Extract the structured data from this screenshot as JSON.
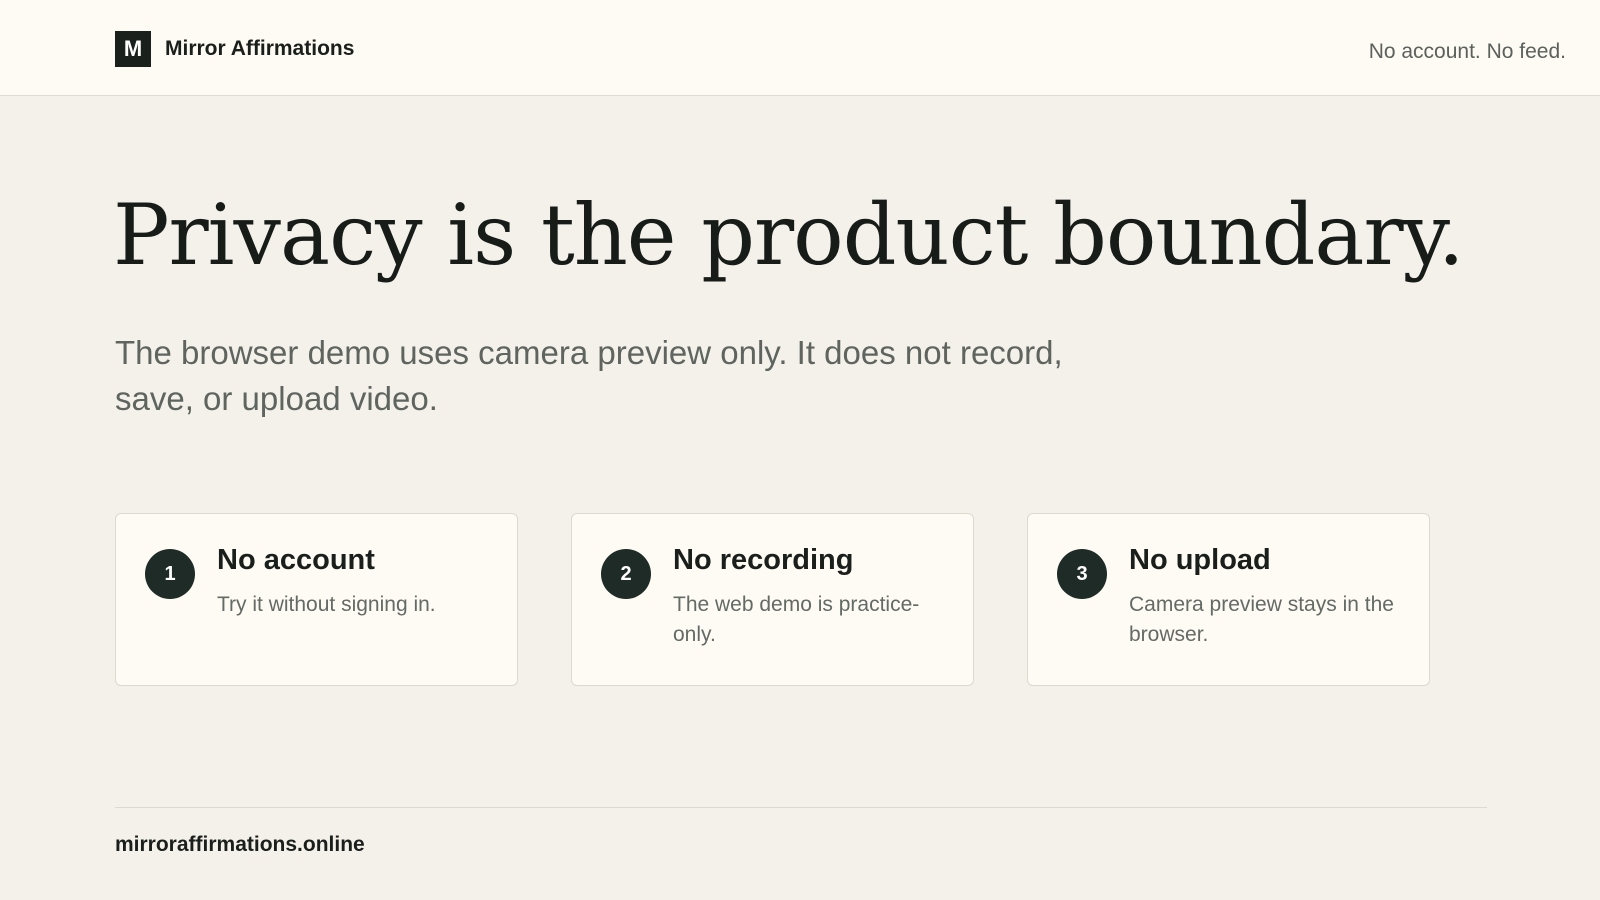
{
  "header": {
    "logo_letter": "M",
    "brand_name": "Mirror Affirmations",
    "tagline": "No account. No feed."
  },
  "hero": {
    "title": "Privacy is the product boundary.",
    "subtitle": "The browser demo uses camera preview only. It does not record, save, or upload video."
  },
  "cards": [
    {
      "number": "1",
      "title": "No account",
      "description": "Try it without signing in."
    },
    {
      "number": "2",
      "title": "No recording",
      "description": "The web demo is practice-only."
    },
    {
      "number": "3",
      "title": "No upload",
      "description": "Camera preview stays in the browser."
    }
  ],
  "footer": {
    "domain": "mirroraffirmations.online"
  },
  "colors": {
    "page_background": "#f3f1ea",
    "header_background": "#fdfbf3",
    "accent_dark": "#1f2b26",
    "text_primary": "#1b1f1c",
    "text_muted": "#5f645f"
  }
}
